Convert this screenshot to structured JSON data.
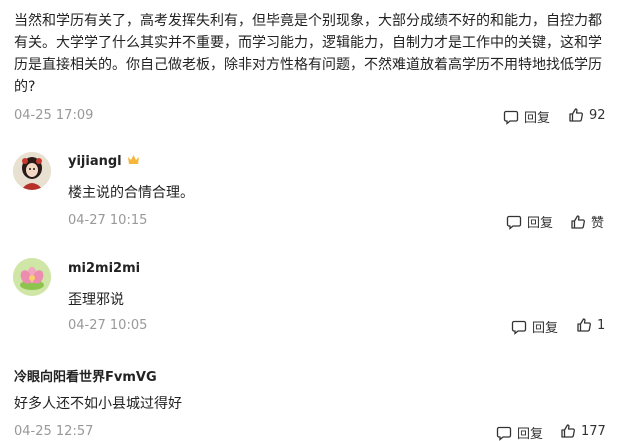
{
  "post": {
    "text": "当然和学历有关了，高考发挥失利有，但毕竟是个别现象，大部分成绩不好的和能力，自控力都有关。大学学了什么其实并不重要，而学习能力，逻辑能力，自制力才是工作中的关键，这和学历是直接相关的。你自己做老板，除非对方性格有问题，不然难道放着高学历不用特地找低学历的?",
    "time": "04-25 17:09",
    "reply_label": "回复",
    "like_count": "92"
  },
  "comments": [
    {
      "username": "yijiangl",
      "text": "楼主说的合情合理。",
      "time": "04-27 10:15",
      "reply_label": "回复",
      "like_label": "赞"
    },
    {
      "username": "mi2mi2mi",
      "text": "歪理邪说",
      "time": "04-27 10:05",
      "reply_label": "回复",
      "like_count": "1"
    },
    {
      "username": "冷眼向阳看世界FvmVG",
      "text": "好多人还不如小县城过得好",
      "time": "04-25 12:57",
      "reply_label": "回复",
      "like_count": "177"
    }
  ],
  "icons": {
    "reply": "comment-bubble-icon",
    "like": "thumbs-up-icon",
    "crown": "crown-badge-icon"
  }
}
